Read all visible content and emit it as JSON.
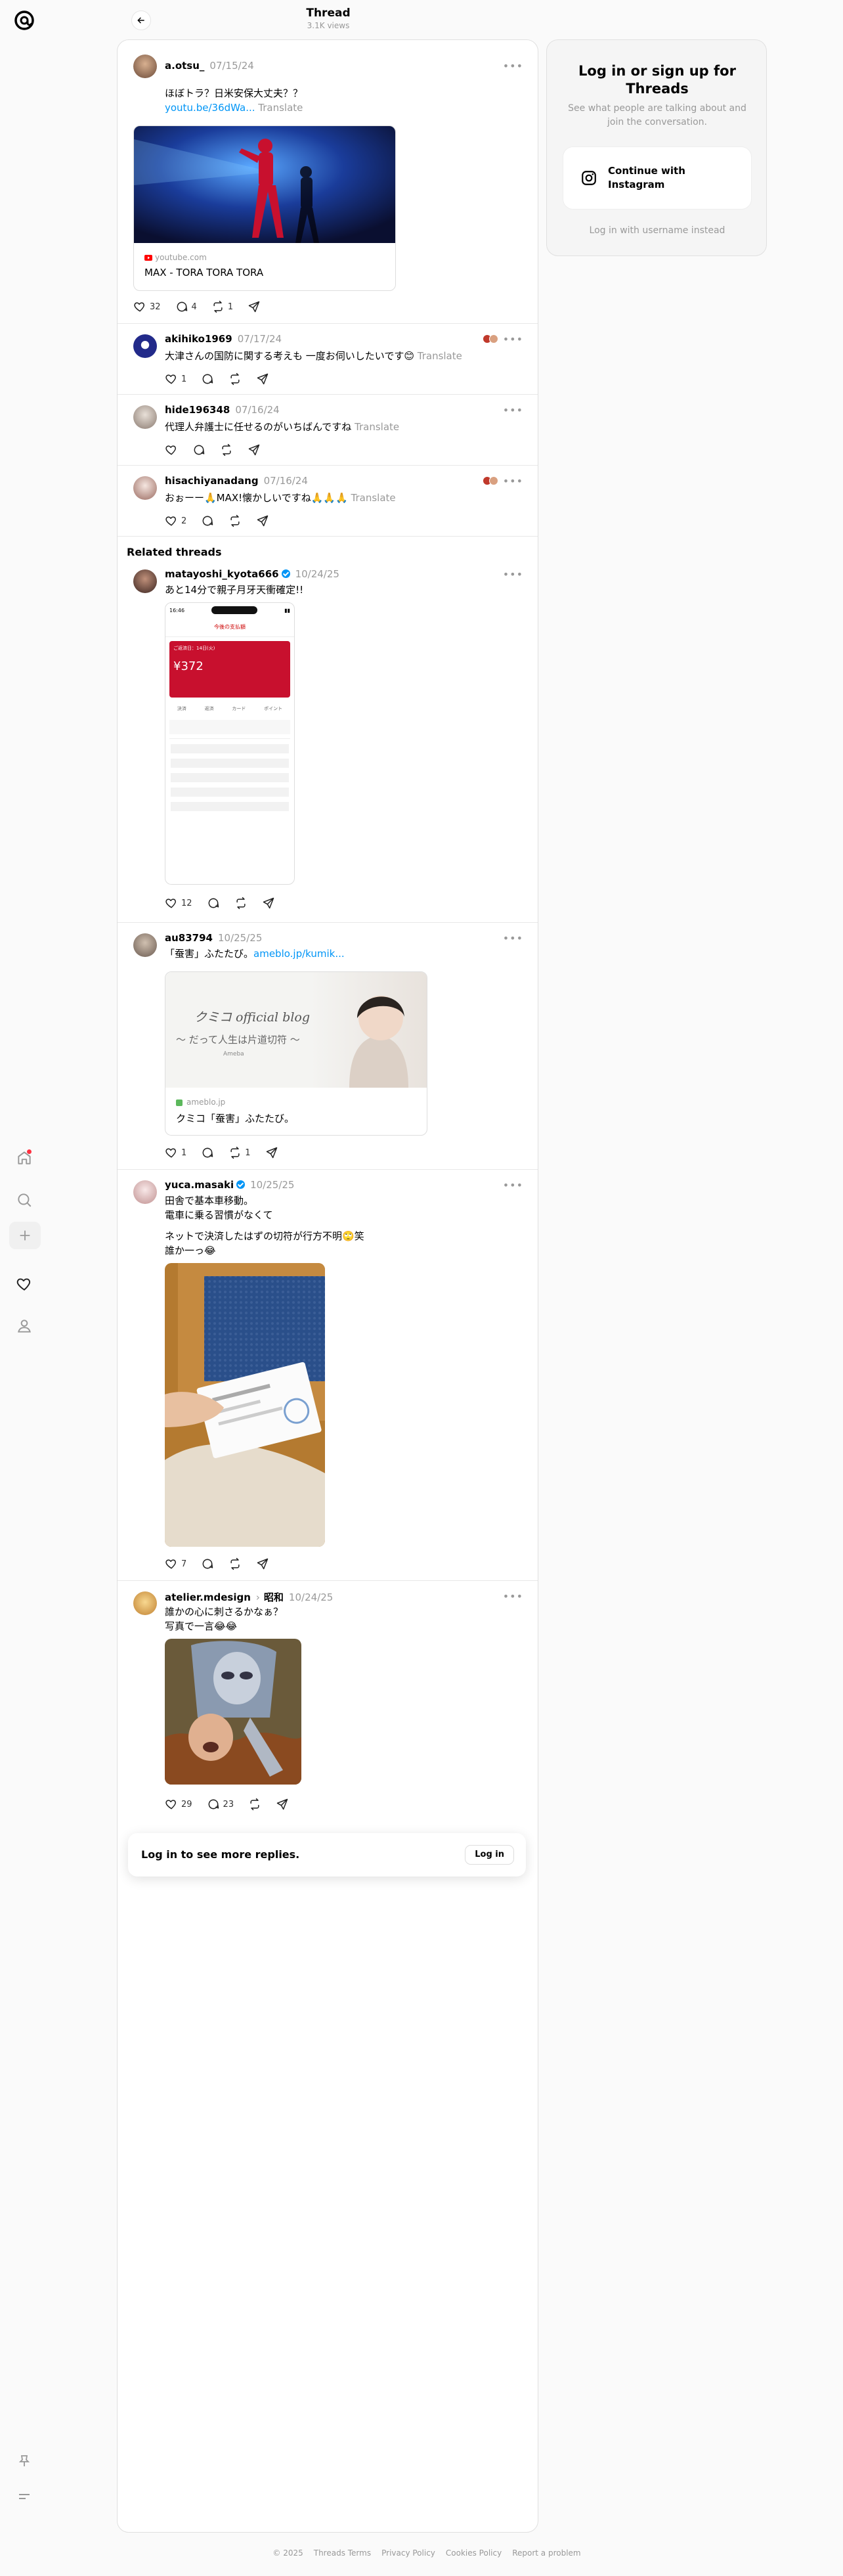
{
  "header": {
    "title": "Thread",
    "views": "3.1K views"
  },
  "main_post": {
    "username": "a.otsu_",
    "date": "07/15/24",
    "text": "ほぼトラ？日米安保大丈夫？？",
    "link": "youtu.be/36dWa...",
    "translate": "Translate",
    "card_domain": "youtube.com",
    "card_title": "MAX - TORA TORA TORA",
    "likes": "32",
    "replies": "4",
    "reposts": "1"
  },
  "replies": [
    {
      "username": "akihiko1969",
      "date": "07/17/24",
      "text": "大津さんの国防に関する考えも 一度お伺いしたいです😊",
      "translate": "Translate",
      "likes": "1",
      "replies": "",
      "reposts": ""
    },
    {
      "username": "hide196348",
      "date": "07/16/24",
      "text": "代理人弁護士に任せるのがいちばんですね",
      "translate": "Translate",
      "likes": "",
      "replies": "",
      "reposts": ""
    },
    {
      "username": "hisachiyanadang",
      "date": "07/16/24",
      "text": "おぉーー🙏MAX!懐かしいですね🙏🙏🙏",
      "translate": "Translate",
      "likes": "2",
      "replies": "",
      "reposts": ""
    }
  ],
  "related": {
    "heading": "Related threads",
    "posts": [
      {
        "username": "matayoshi_kyota666",
        "date": "10/24/25",
        "text": "あと14分で親子月牙天衝確定!!",
        "likes": "12",
        "replies": "",
        "reposts": "",
        "phone": {
          "time": "16:46",
          "header": "今後の支払額",
          "label": "ご返済日：14日(火)",
          "amount": "¥372",
          "items": [
            "決済",
            "返済",
            "カード",
            "ポイント"
          ]
        }
      },
      {
        "username": "au83794",
        "date": "10/25/25",
        "text": "「蚕害」ふたたび。",
        "link": "ameblo.jp/kumik...",
        "card_banner": "クミコ official blog",
        "card_tag": "〜 だって人生は片道切符 〜",
        "card_brand": "Ameba",
        "card_domain": "ameblo.jp",
        "card_title": "クミコ「蚕害」ふたたび。",
        "likes": "1",
        "replies": "",
        "reposts": "1"
      },
      {
        "username": "yuca.masaki",
        "date": "10/25/25",
        "lines": [
          "田舎で基本車移動。",
          "電車に乗る習慣がなくて",
          "",
          "ネットで決済したはずの切符が行方不明🙄笑",
          "誰か一っ😂"
        ],
        "likes": "7",
        "replies": "",
        "reposts": ""
      },
      {
        "username": "atelier.mdesign",
        "sub": "昭和",
        "date": "10/24/25",
        "lines": [
          "誰かの心に刺さるかなぁ？",
          "写真で一言😂😂"
        ],
        "likes": "29",
        "replies": "23",
        "reposts": ""
      }
    ]
  },
  "login_bar": {
    "text": "Log in to see more replies.",
    "button": "Log in"
  },
  "side_panel": {
    "title": "Log in or sign up for Threads",
    "subtitle": "See what people are talking about and join the conversation.",
    "instagram_button": "Continue with Instagram",
    "alt_login": "Log in with username instead"
  },
  "footer": [
    "© 2025",
    "Threads Terms",
    "Privacy Policy",
    "Cookies Policy",
    "Report a problem"
  ],
  "colors": {
    "accent": "#0095f6",
    "notification": "#ff3040"
  },
  "icons": {
    "logo": "threads-logo-icon",
    "home": "home-icon",
    "search": "search-icon",
    "create": "plus-icon",
    "activity": "heart-icon",
    "profile": "profile-icon",
    "pin": "pin-icon",
    "menu": "menu-icon"
  }
}
